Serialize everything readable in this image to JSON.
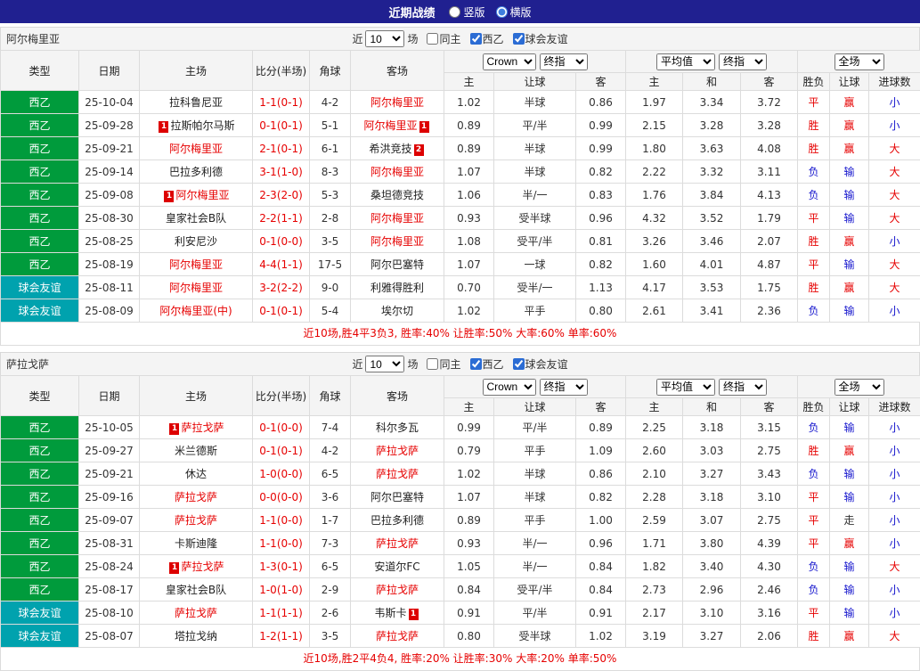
{
  "topbar": {
    "title": "近期战绩",
    "layout_options": [
      {
        "key": "vertical",
        "label": "竖版",
        "checked": false
      },
      {
        "key": "horizontal",
        "label": "横版",
        "checked": true
      }
    ]
  },
  "filter": {
    "prefix": "近",
    "count": "10",
    "suffix": "场",
    "checkboxes": [
      {
        "key": "same-home",
        "label": "同主",
        "checked": false
      },
      {
        "key": "league",
        "label": "西乙",
        "checked": true
      },
      {
        "key": "friendly",
        "label": "球会友谊",
        "checked": true
      }
    ]
  },
  "table_header": {
    "base_cols": [
      "类型",
      "日期",
      "主场",
      "比分(半场)",
      "角球",
      "客场"
    ],
    "groups": [
      {
        "selects": [
          {
            "key": "bookmaker-select",
            "value": "Crown"
          },
          {
            "key": "handicap-stage-select",
            "value": "终指"
          }
        ],
        "cols": [
          "主",
          "让球",
          "客"
        ]
      },
      {
        "selects": [
          {
            "key": "average-select",
            "value": "平均值"
          },
          {
            "key": "europe-stage-select",
            "value": "终指"
          }
        ],
        "cols": [
          "主",
          "和",
          "客"
        ]
      },
      {
        "selects": [
          {
            "key": "scope-select",
            "value": "全场"
          }
        ],
        "cols": [
          "胜负",
          "让球",
          "进球数"
        ]
      }
    ]
  },
  "league_colors": {
    "西乙": "#009b3c",
    "球会友谊": "#00a2ae"
  },
  "result_colors": {
    "red": "#e60000",
    "blue": "#1515cd",
    "dark": "#333333"
  },
  "sections": [
    {
      "team": "阿尔梅里亚",
      "rows": [
        {
          "type": "西乙",
          "date": "25-10-04",
          "home": {
            "name": "拉科鲁尼亚",
            "red": false
          },
          "score": "1-1(0-1)",
          "corners": "4-2",
          "away": {
            "name": "阿尔梅里亚",
            "red": true
          },
          "odds": [
            "1.02",
            "半球",
            "0.86"
          ],
          "avg": [
            "1.97",
            "3.34",
            "3.72"
          ],
          "res": [
            {
              "t": "平",
              "c": "red"
            },
            {
              "t": "赢",
              "c": "red"
            },
            {
              "t": "小",
              "c": "blue"
            }
          ]
        },
        {
          "type": "西乙",
          "date": "25-09-28",
          "home": {
            "name": "拉斯帕尔马斯",
            "red": false,
            "badge": "1",
            "badge_pos": "before"
          },
          "score": "0-1(0-1)",
          "corners": "5-1",
          "away": {
            "name": "阿尔梅里亚",
            "red": true,
            "badge": "1",
            "badge_pos": "after"
          },
          "odds": [
            "0.89",
            "平/半",
            "0.99"
          ],
          "avg": [
            "2.15",
            "3.28",
            "3.28"
          ],
          "res": [
            {
              "t": "胜",
              "c": "red"
            },
            {
              "t": "赢",
              "c": "red"
            },
            {
              "t": "小",
              "c": "blue"
            }
          ]
        },
        {
          "type": "西乙",
          "date": "25-09-21",
          "home": {
            "name": "阿尔梅里亚",
            "red": true
          },
          "score": "2-1(0-1)",
          "corners": "6-1",
          "away": {
            "name": "希洪竞技",
            "red": false,
            "badge": "2",
            "badge_pos": "after"
          },
          "odds": [
            "0.89",
            "半球",
            "0.99"
          ],
          "avg": [
            "1.80",
            "3.63",
            "4.08"
          ],
          "res": [
            {
              "t": "胜",
              "c": "red"
            },
            {
              "t": "赢",
              "c": "red"
            },
            {
              "t": "大",
              "c": "red"
            }
          ]
        },
        {
          "type": "西乙",
          "date": "25-09-14",
          "home": {
            "name": "巴拉多利德",
            "red": false
          },
          "score": "3-1(1-0)",
          "corners": "8-3",
          "away": {
            "name": "阿尔梅里亚",
            "red": true
          },
          "odds": [
            "1.07",
            "半球",
            "0.82"
          ],
          "avg": [
            "2.22",
            "3.32",
            "3.11"
          ],
          "res": [
            {
              "t": "负",
              "c": "blue"
            },
            {
              "t": "输",
              "c": "blue"
            },
            {
              "t": "大",
              "c": "red"
            }
          ]
        },
        {
          "type": "西乙",
          "date": "25-09-08",
          "home": {
            "name": "阿尔梅里亚",
            "red": true,
            "badge": "1",
            "badge_pos": "before"
          },
          "score": "2-3(2-0)",
          "corners": "5-3",
          "away": {
            "name": "桑坦德竞技",
            "red": false
          },
          "odds": [
            "1.06",
            "半/一",
            "0.83"
          ],
          "avg": [
            "1.76",
            "3.84",
            "4.13"
          ],
          "res": [
            {
              "t": "负",
              "c": "blue"
            },
            {
              "t": "输",
              "c": "blue"
            },
            {
              "t": "大",
              "c": "red"
            }
          ]
        },
        {
          "type": "西乙",
          "date": "25-08-30",
          "home": {
            "name": "皇家社会B队",
            "red": false
          },
          "score": "2-2(1-1)",
          "corners": "2-8",
          "away": {
            "name": "阿尔梅里亚",
            "red": true
          },
          "odds": [
            "0.93",
            "受半球",
            "0.96"
          ],
          "avg": [
            "4.32",
            "3.52",
            "1.79"
          ],
          "res": [
            {
              "t": "平",
              "c": "red"
            },
            {
              "t": "输",
              "c": "blue"
            },
            {
              "t": "大",
              "c": "red"
            }
          ]
        },
        {
          "type": "西乙",
          "date": "25-08-25",
          "home": {
            "name": "利安尼沙",
            "red": false
          },
          "score": "0-1(0-0)",
          "corners": "3-5",
          "away": {
            "name": "阿尔梅里亚",
            "red": true
          },
          "odds": [
            "1.08",
            "受平/半",
            "0.81"
          ],
          "avg": [
            "3.26",
            "3.46",
            "2.07"
          ],
          "res": [
            {
              "t": "胜",
              "c": "red"
            },
            {
              "t": "赢",
              "c": "red"
            },
            {
              "t": "小",
              "c": "blue"
            }
          ]
        },
        {
          "type": "西乙",
          "date": "25-08-19",
          "home": {
            "name": "阿尔梅里亚",
            "red": true
          },
          "score": "4-4(1-1)",
          "corners": "17-5",
          "away": {
            "name": "阿尔巴塞特",
            "red": false
          },
          "odds": [
            "1.07",
            "一球",
            "0.82"
          ],
          "avg": [
            "1.60",
            "4.01",
            "4.87"
          ],
          "res": [
            {
              "t": "平",
              "c": "red"
            },
            {
              "t": "输",
              "c": "blue"
            },
            {
              "t": "大",
              "c": "red"
            }
          ]
        },
        {
          "type": "球会友谊",
          "date": "25-08-11",
          "home": {
            "name": "阿尔梅里亚",
            "red": true
          },
          "score": "3-2(2-2)",
          "corners": "9-0",
          "away": {
            "name": "利雅得胜利",
            "red": false
          },
          "odds": [
            "0.70",
            "受半/一",
            "1.13"
          ],
          "avg": [
            "4.17",
            "3.53",
            "1.75"
          ],
          "res": [
            {
              "t": "胜",
              "c": "red"
            },
            {
              "t": "赢",
              "c": "red"
            },
            {
              "t": "大",
              "c": "red"
            }
          ]
        },
        {
          "type": "球会友谊",
          "date": "25-08-09",
          "home": {
            "name": "阿尔梅里亚(中)",
            "red": true
          },
          "score": "0-1(0-1)",
          "corners": "5-4",
          "away": {
            "name": "埃尔切",
            "red": false
          },
          "odds": [
            "1.02",
            "平手",
            "0.80"
          ],
          "avg": [
            "2.61",
            "3.41",
            "2.36"
          ],
          "res": [
            {
              "t": "负",
              "c": "blue"
            },
            {
              "t": "输",
              "c": "blue"
            },
            {
              "t": "小",
              "c": "blue"
            }
          ]
        }
      ],
      "summary": "近10场,胜4平3负3, 胜率:40% 让胜率:50% 大率:60% 单率:60%"
    },
    {
      "team": "萨拉戈萨",
      "rows": [
        {
          "type": "西乙",
          "date": "25-10-05",
          "home": {
            "name": "萨拉戈萨",
            "red": true,
            "badge": "1",
            "badge_pos": "before"
          },
          "score": "0-1(0-0)",
          "corners": "7-4",
          "away": {
            "name": "科尔多瓦",
            "red": false
          },
          "odds": [
            "0.99",
            "平/半",
            "0.89"
          ],
          "avg": [
            "2.25",
            "3.18",
            "3.15"
          ],
          "res": [
            {
              "t": "负",
              "c": "blue"
            },
            {
              "t": "输",
              "c": "blue"
            },
            {
              "t": "小",
              "c": "blue"
            }
          ]
        },
        {
          "type": "西乙",
          "date": "25-09-27",
          "home": {
            "name": "米兰德斯",
            "red": false
          },
          "score": "0-1(0-1)",
          "corners": "4-2",
          "away": {
            "name": "萨拉戈萨",
            "red": true
          },
          "odds": [
            "0.79",
            "平手",
            "1.09"
          ],
          "avg": [
            "2.60",
            "3.03",
            "2.75"
          ],
          "res": [
            {
              "t": "胜",
              "c": "red"
            },
            {
              "t": "赢",
              "c": "red"
            },
            {
              "t": "小",
              "c": "blue"
            }
          ]
        },
        {
          "type": "西乙",
          "date": "25-09-21",
          "home": {
            "name": "休达",
            "red": false
          },
          "score": "1-0(0-0)",
          "corners": "6-5",
          "away": {
            "name": "萨拉戈萨",
            "red": true
          },
          "odds": [
            "1.02",
            "半球",
            "0.86"
          ],
          "avg": [
            "2.10",
            "3.27",
            "3.43"
          ],
          "res": [
            {
              "t": "负",
              "c": "blue"
            },
            {
              "t": "输",
              "c": "blue"
            },
            {
              "t": "小",
              "c": "blue"
            }
          ]
        },
        {
          "type": "西乙",
          "date": "25-09-16",
          "home": {
            "name": "萨拉戈萨",
            "red": true
          },
          "score": "0-0(0-0)",
          "corners": "3-6",
          "away": {
            "name": "阿尔巴塞特",
            "red": false
          },
          "odds": [
            "1.07",
            "半球",
            "0.82"
          ],
          "avg": [
            "2.28",
            "3.18",
            "3.10"
          ],
          "res": [
            {
              "t": "平",
              "c": "red"
            },
            {
              "t": "输",
              "c": "blue"
            },
            {
              "t": "小",
              "c": "blue"
            }
          ]
        },
        {
          "type": "西乙",
          "date": "25-09-07",
          "home": {
            "name": "萨拉戈萨",
            "red": true
          },
          "score": "1-1(0-0)",
          "corners": "1-7",
          "away": {
            "name": "巴拉多利德",
            "red": false
          },
          "odds": [
            "0.89",
            "平手",
            "1.00"
          ],
          "avg": [
            "2.59",
            "3.07",
            "2.75"
          ],
          "res": [
            {
              "t": "平",
              "c": "red"
            },
            {
              "t": "走",
              "c": "dark"
            },
            {
              "t": "小",
              "c": "blue"
            }
          ]
        },
        {
          "type": "西乙",
          "date": "25-08-31",
          "home": {
            "name": "卡斯迪隆",
            "red": false
          },
          "score": "1-1(0-0)",
          "corners": "7-3",
          "away": {
            "name": "萨拉戈萨",
            "red": true
          },
          "odds": [
            "0.93",
            "半/一",
            "0.96"
          ],
          "avg": [
            "1.71",
            "3.80",
            "4.39"
          ],
          "res": [
            {
              "t": "平",
              "c": "red"
            },
            {
              "t": "赢",
              "c": "red"
            },
            {
              "t": "小",
              "c": "blue"
            }
          ]
        },
        {
          "type": "西乙",
          "date": "25-08-24",
          "home": {
            "name": "萨拉戈萨",
            "red": true,
            "badge": "1",
            "badge_pos": "before"
          },
          "score": "1-3(0-1)",
          "corners": "6-5",
          "away": {
            "name": "安道尔FC",
            "red": false
          },
          "odds": [
            "1.05",
            "半/一",
            "0.84"
          ],
          "avg": [
            "1.82",
            "3.40",
            "4.30"
          ],
          "res": [
            {
              "t": "负",
              "c": "blue"
            },
            {
              "t": "输",
              "c": "blue"
            },
            {
              "t": "大",
              "c": "red"
            }
          ]
        },
        {
          "type": "西乙",
          "date": "25-08-17",
          "home": {
            "name": "皇家社会B队",
            "red": false
          },
          "score": "1-0(1-0)",
          "corners": "2-9",
          "away": {
            "name": "萨拉戈萨",
            "red": true
          },
          "odds": [
            "0.84",
            "受平/半",
            "0.84"
          ],
          "avg": [
            "2.73",
            "2.96",
            "2.46"
          ],
          "res": [
            {
              "t": "负",
              "c": "blue"
            },
            {
              "t": "输",
              "c": "blue"
            },
            {
              "t": "小",
              "c": "blue"
            }
          ]
        },
        {
          "type": "球会友谊",
          "date": "25-08-10",
          "home": {
            "name": "萨拉戈萨",
            "red": true
          },
          "score": "1-1(1-1)",
          "corners": "2-6",
          "away": {
            "name": "韦斯卡",
            "red": false,
            "badge": "1",
            "badge_pos": "after"
          },
          "odds": [
            "0.91",
            "平/半",
            "0.91"
          ],
          "avg": [
            "2.17",
            "3.10",
            "3.16"
          ],
          "res": [
            {
              "t": "平",
              "c": "red"
            },
            {
              "t": "输",
              "c": "blue"
            },
            {
              "t": "小",
              "c": "blue"
            }
          ]
        },
        {
          "type": "球会友谊",
          "date": "25-08-07",
          "home": {
            "name": "塔拉戈纳",
            "red": false
          },
          "score": "1-2(1-1)",
          "corners": "3-5",
          "away": {
            "name": "萨拉戈萨",
            "red": true
          },
          "odds": [
            "0.80",
            "受半球",
            "1.02"
          ],
          "avg": [
            "3.19",
            "3.27",
            "2.06"
          ],
          "res": [
            {
              "t": "胜",
              "c": "red"
            },
            {
              "t": "赢",
              "c": "red"
            },
            {
              "t": "大",
              "c": "red"
            }
          ]
        }
      ],
      "summary": "近10场,胜2平4负4, 胜率:20% 让胜率:30% 大率:20% 单率:50%"
    }
  ]
}
